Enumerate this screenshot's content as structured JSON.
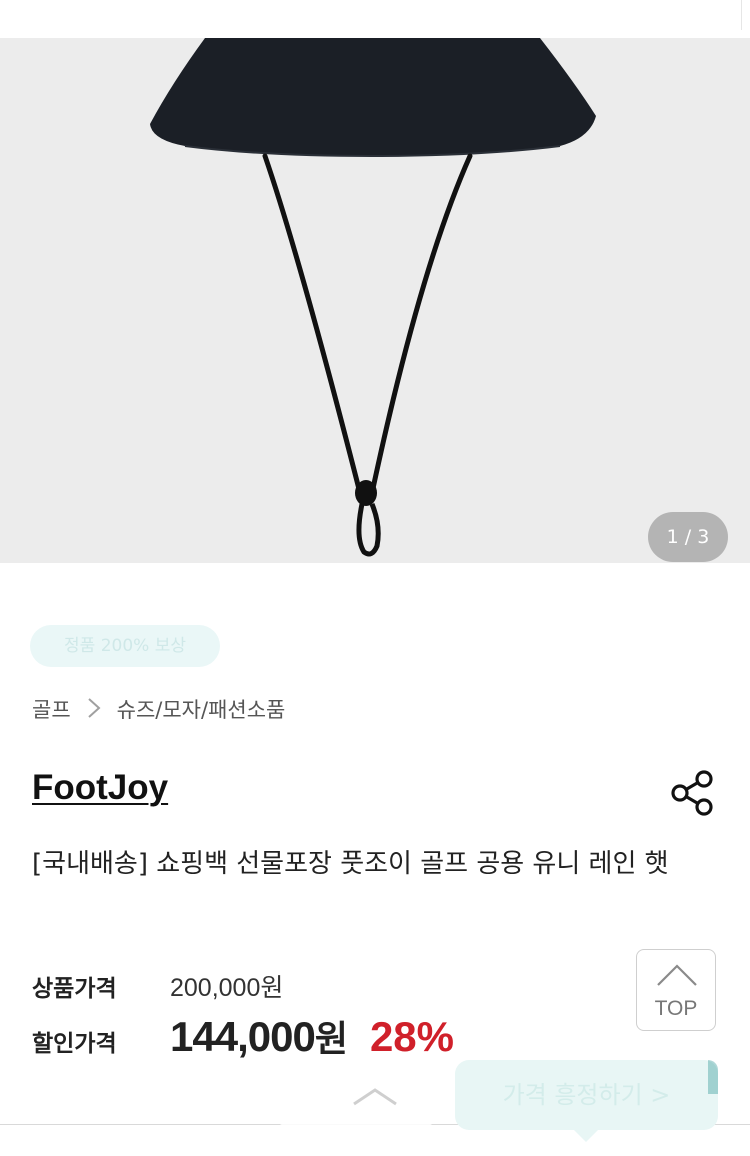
{
  "gallery": {
    "pager": "1 / 3",
    "image_alt": "rain hat product image"
  },
  "badge": "정품 200% 보상",
  "breadcrumb": {
    "level1": "골프",
    "level2": "슈즈/모자/패션소품"
  },
  "product": {
    "brand": "FootJoy",
    "title": "[국내배송] 쇼핑백 선물포장 풋조이 골프 공용 유니 레인 햇"
  },
  "price": {
    "list_label": "상품가격",
    "list_value": "200,000원",
    "sale_label": "할인가격",
    "sale_value": "144,000",
    "sale_unit": "원",
    "discount_rate": "28%"
  },
  "buttons": {
    "top_label": "TOP",
    "price_alert_label": "가격 흥정하기 >"
  },
  "colors": {
    "discount": "#d0202a",
    "accent": "#1a8c8c"
  },
  "icons": {
    "breadcrumb_separator": "chevron-right-icon",
    "share": "share-icon",
    "top": "chevron-up-icon"
  }
}
